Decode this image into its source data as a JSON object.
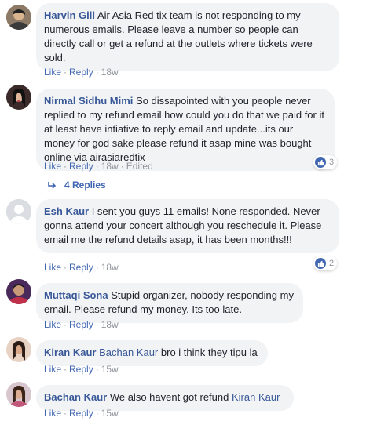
{
  "comments": [
    {
      "author": "Harvin Gill",
      "text": "Air Asia Red tix team is not responding to my numerous emails. Please leave a number so people can directly call or get a refund at the outlets where tickets were sold.",
      "like": "Like",
      "reply": "Reply",
      "time": "18w"
    },
    {
      "author": "Nirmal Sidhu Mimi",
      "text": "So dissapointed with you people never replied to my refund email how could you do that we paid for it at least have intiative to reply email and update...its our money for god sake please refund it asap mine was bought online via airasiaredtix",
      "like": "Like",
      "reply": "Reply",
      "time": "18w",
      "edited": "Edited",
      "reaction_count": "3",
      "replies_label": "4 Replies"
    },
    {
      "author": "Esh Kaur",
      "text": "I sent you guys 11 emails! None responded. Never gonna attend your concert although you reschedule it. Please email me the refund details asap, it has been months!!!",
      "like": "Like",
      "reply": "Reply",
      "time": "18w",
      "reaction_count": "2"
    },
    {
      "author": "Muttaqi Sona",
      "text": "Stupid organizer, nobody responding my email. Please refund my money. Its too late.",
      "like": "Like",
      "reply": "Reply",
      "time": "18w"
    },
    {
      "author": "Kiran Kaur",
      "mention": "Bachan Kaur",
      "text": "bro i think they tipu la",
      "like": "Like",
      "reply": "Reply",
      "time": "15w"
    },
    {
      "author": "Bachan Kaur",
      "text": "We also havent got refund",
      "mention": "Kiran Kaur",
      "like": "Like",
      "reply": "Reply",
      "time": "15w"
    }
  ],
  "colors": {
    "link": "#385898",
    "action": "#4267b2",
    "meta": "#90949c",
    "bubble": "#f2f3f5"
  },
  "icons": [
    "like-icon",
    "reply-arrow-icon",
    "default-avatar-icon"
  ]
}
